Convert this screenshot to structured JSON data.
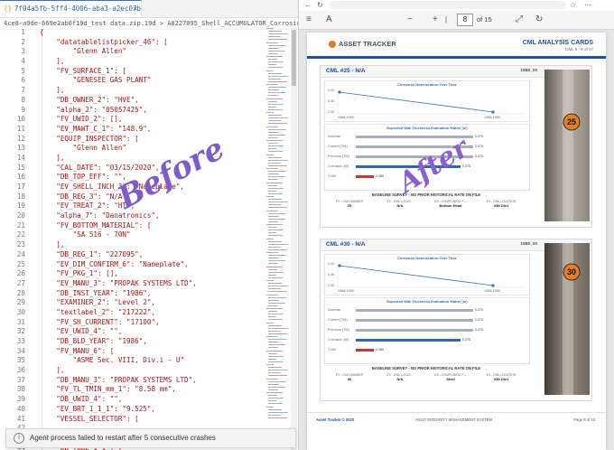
{
  "editor": {
    "tab_title": "7f04a5fb-5ff4-4006-aba3-a2ec07becb64.json",
    "breadcrumb": "4ce8-a9de-669e2ab0f19d_test data.zip.19d > A0227095_Shell_ACCUMULATOR_Corrosion Survey_04-15",
    "lines": [
      {
        "n": "1",
        "t": "{"
      },
      {
        "n": "2",
        "t": "    \"datatablelistpicker_46\": ["
      },
      {
        "n": "3",
        "t": "        \"Glenn Allen\""
      },
      {
        "n": "4",
        "t": "    ],"
      },
      {
        "n": "5",
        "t": "    \"FV_SURFACE_1\": ["
      },
      {
        "n": "6",
        "t": "        \"GENESEE GAS PLANT\""
      },
      {
        "n": "7",
        "t": "    ],"
      },
      {
        "n": "8",
        "t": "    \"DB_OWNER_2\": \"HVE\","
      },
      {
        "n": "9",
        "t": "    \"alpha_2\": \"05057425\","
      },
      {
        "n": "10",
        "t": "    \"FV_UWID_2\": [],"
      },
      {
        "n": "11",
        "t": "    \"EV_MAWT_C_1\": \"148.9\","
      },
      {
        "n": "12",
        "t": "    \"EQUIP_INSPECTOR\": ["
      },
      {
        "n": "13",
        "t": "        \"Glenn Allen\""
      },
      {
        "n": "14",
        "t": "    ],"
      },
      {
        "n": "15",
        "t": "    \"CAL_DATE\": \"03/15/2020\","
      },
      {
        "n": "16",
        "t": "    \"DB_TOP_EFF\": \"\","
      },
      {
        "n": "17",
        "t": "    \"EV_SHELL_INCH_3\": \"Nameplate\","
      },
      {
        "n": "18",
        "t": "    \"DB_REG_3\": \"N/A\","
      },
      {
        "n": "19",
        "t": "    \"EV_TREAT_2\": \"HT\","
      },
      {
        "n": "20",
        "t": "    \"alpha_7\": \"Danatronics\","
      },
      {
        "n": "21",
        "t": "    \"FV_BOTTOM_MATERIAL\": ["
      },
      {
        "n": "22",
        "t": "        \"SA 516 - 70N\""
      },
      {
        "n": "23",
        "t": "    ],"
      },
      {
        "n": "24",
        "t": "    \"DB_REG_1\": \"227095\","
      },
      {
        "n": "25",
        "t": "    \"EV_DIM_CONFIRM_6\": \"Nameplate\","
      },
      {
        "n": "26",
        "t": "    \"FV_PKG_1\": [],"
      },
      {
        "n": "27",
        "t": "    \"EV_MANU_3\": \"PROPAK SYSTEMS LTD\","
      },
      {
        "n": "28",
        "t": "    \"DB_INST_YEAR\": \"1986\","
      },
      {
        "n": "29",
        "t": "    \"EXAMINER_2\": \"Level 2\","
      },
      {
        "n": "30",
        "t": "    \"textlabel_2\": \"217222\","
      },
      {
        "n": "31",
        "t": "    \"FV_SH_CURRENT\": \"17100\","
      },
      {
        "n": "32",
        "t": "    \"EV_UWID_4\": \"\","
      },
      {
        "n": "33",
        "t": "    \"DB_BLD_YEAR\": \"1986\","
      },
      {
        "n": "34",
        "t": "    \"FV_MANU_6\": ["
      },
      {
        "n": "35",
        "t": "        \"ASME Sec. VIII, Div.i - U\""
      },
      {
        "n": "36",
        "t": "    ],"
      },
      {
        "n": "37",
        "t": "    \"DB_MANU_3\": \"PROPAK SYSTEMS LTD\","
      },
      {
        "n": "38",
        "t": "    \"FV_TL_TMIN_mm_1\": \"8.58 mm\","
      },
      {
        "n": "39",
        "t": "    \"DB_UWID_4\": \"\","
      },
      {
        "n": "40",
        "t": "    \"EV_BRT_1_1_1\": \"9.525\","
      },
      {
        "n": "41",
        "t": "    \"VESSEL_SELECTOR\": ["
      },
      {
        "n": "42",
        "t": ""
      },
      {
        "n": "43",
        "t": ""
      },
      {
        "n": "44",
        "t": "    \"DB_TUBE_1_1\": ["
      }
    ],
    "annotation": "Before",
    "toast": "Agent process failed to restart after 5 consecutive crashes"
  },
  "viewer": {
    "page_number": "8",
    "page_of": "of 15",
    "annotation": "After",
    "header": {
      "logo": "ASSET TRACKER",
      "title": "CML ANALYSIS CARDS",
      "subtitle": "CML 8 - 8 of 17"
    },
    "cards": [
      {
        "title": "CML #25 - N/A",
        "id": "1988_25",
        "chart1_title": "Corrosion Deterioration Over Time",
        "chart1_y": [
          "0.40",
          "0.35",
          "0.30"
        ],
        "chart1_x": [
          "1988-1990",
          "1988-1990"
        ],
        "chart2_title": "Expected Wall Thickness Evaluation Matrix (in)",
        "rows": [
          {
            "label": "Nominal",
            "value": "0.375"
          },
          {
            "label": "Current (TM)",
            "value": "0.375"
          },
          {
            "label": "Previous (TM)",
            "value": "0.375"
          },
          {
            "label": "Corrosion (M)",
            "value": "0.375"
          },
          {
            "label": "T-Min",
            "value": "0.088"
          }
        ],
        "baseline": "BASELINE SURVEY - NO PRIOR HISTORICAL RATE ON FILE",
        "cols": [
          {
            "h": "EV - CML NUMBER",
            "v": "25"
          },
          {
            "h": "EV - CML LOCAT...",
            "v": "N/A"
          },
          {
            "h": "EV - COMPONENT T...",
            "v": "Bottom Head"
          },
          {
            "h": "EV - CML LOCATION",
            "v": "VIM Div1"
          }
        ],
        "photo_label": "25"
      },
      {
        "title": "CML #30 - N/A",
        "id": "1988_30",
        "chart1_title": "Corrosion Deterioration Over Time",
        "chart1_y": [
          "0.40",
          "0.35",
          "0.30"
        ],
        "chart1_x": [
          "1988-1990",
          "1988-1990"
        ],
        "chart2_title": "Expected Wall Thickness Evaluation Matrix (in)",
        "rows": [
          {
            "label": "Nominal",
            "value": "0.375"
          },
          {
            "label": "Current (TM)",
            "value": "0.375"
          },
          {
            "label": "Previous (TM)",
            "value": "0.375"
          },
          {
            "label": "Corrosion (M)",
            "value": "0.375"
          },
          {
            "label": "T-Min",
            "value": "0.088"
          }
        ],
        "baseline": "BASELINE SURVEY - NO PRIOR HISTORICAL RATE ON FILE",
        "cols": [
          {
            "h": "EV - CML NUMBER",
            "v": "30"
          },
          {
            "h": "EV - CML LOCAT...",
            "v": "N/A"
          },
          {
            "h": "EV - COMPONENT T...",
            "v": "Shell"
          },
          {
            "h": "EV - CML LOCATION",
            "v": "VIM Div1"
          }
        ],
        "photo_label": "30"
      }
    ],
    "footer": {
      "left": "Asset Tracker © 2020",
      "center": "A0227 INTEGRITY MANAGEMENT SYSTEM",
      "right": "Page 8 of 15"
    }
  }
}
